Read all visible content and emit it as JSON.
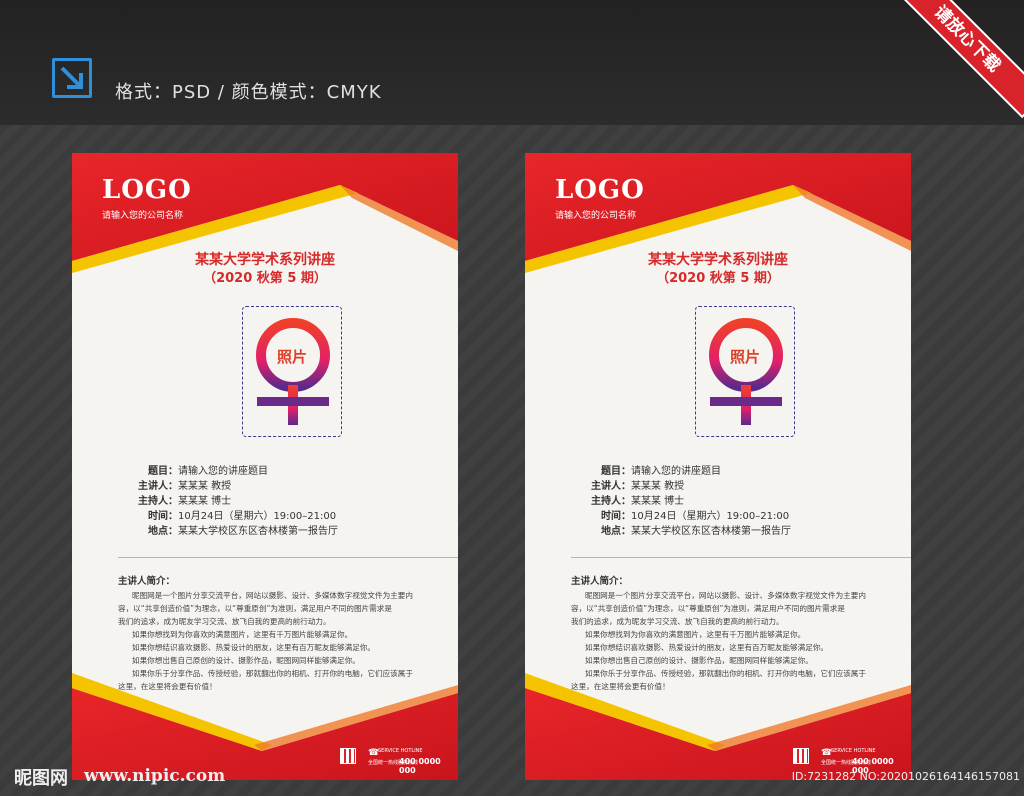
{
  "header": {
    "format_text": "格式：PSD  /  颜色模式：CMYK",
    "ribbon": "请放心下载"
  },
  "poster": {
    "logo": "LOGO",
    "company": "请输入您的公司名称",
    "title": "某某大学学术系列讲座",
    "subtitle": "（2020 秋第 5 期）",
    "photo_label": "照片",
    "info": [
      {
        "key": "题目：",
        "value": "请输入您的讲座题目"
      },
      {
        "key": "主讲人：",
        "value": "某某某  教授"
      },
      {
        "key": "主持人：",
        "value": "某某某  博士"
      },
      {
        "key": "时间：",
        "value": "10月24日（星期六）19:00–21:00"
      },
      {
        "key": "地点：",
        "value": "某某大学校区东区杏林楼第一报告厅"
      }
    ],
    "bio_heading": "主讲人简介：",
    "bio_lines": [
      "昵图网是一个图片分享交流平台，网站以摄影、设计、多媒体数字视觉文件为主要内",
      "容，以“共享创造价值”为理念，以“尊重原创”为准则，满足用户不同的图片需求是",
      "我们的追求，成为昵友学习交流、放飞自我的更高的前行动力。",
      "如果你想找到为你喜欢的满意图片，这里有千万图片能够满足你。",
      "如果你想结识喜欢摄影、热爱设计的朋友，这里有百万昵友能够满足你。",
      "如果你想出售自己原创的设计、摄影作品，昵图网同样能够满足你。",
      "如果你乐于分享作品、传授经验，那就翻出你的相机、打开你的电脑，它们应该属于",
      "这里，在这里将会更有价值！"
    ],
    "hotline_label": "SERVICE HOTLINE",
    "hotline_sub": "全国统一热线服务热线",
    "phone": "400 0000 000"
  },
  "footer": {
    "watermark": "昵图网",
    "url": "www.nipic.com",
    "id_text": "ID:7231282 NO:20201026164146157081"
  },
  "colors": {
    "red": "#d9232a",
    "yellow": "#f5c400",
    "paper": "#f5f4f0",
    "accent": "#2f8fd8"
  }
}
